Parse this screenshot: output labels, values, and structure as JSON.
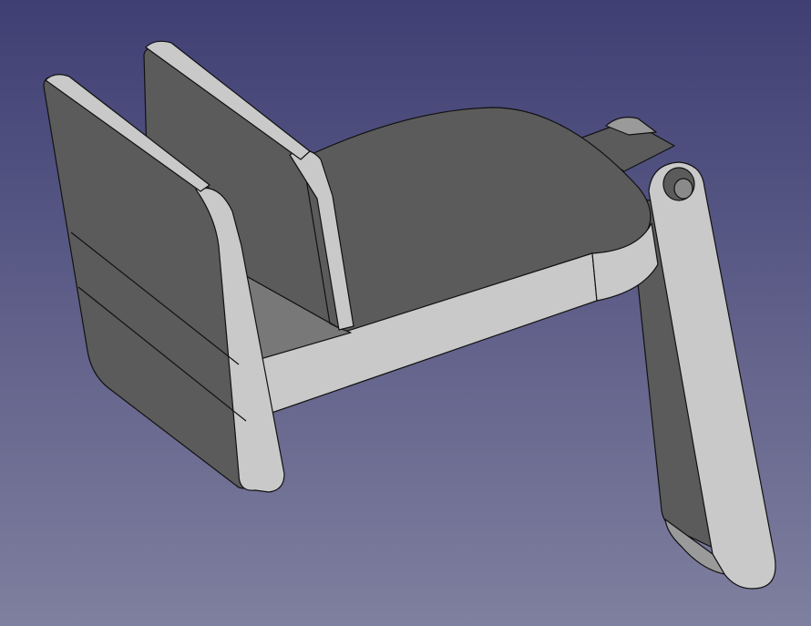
{
  "viewport": {
    "background_top": "#3f3f74",
    "background_bottom": "#7f7f9f"
  },
  "model": {
    "dark_face": "#5b5b5b",
    "mid_face": "#8a8a8a",
    "light_face": "#c9c9c9",
    "edge_color": "#111111"
  }
}
